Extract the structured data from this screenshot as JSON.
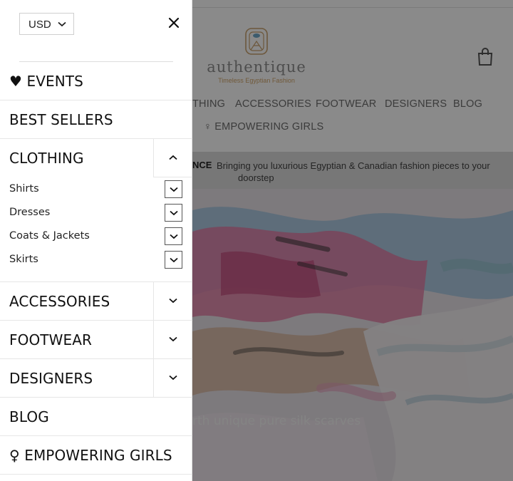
{
  "site": {
    "brand_name": "authentique",
    "tagline": "Timeless Egyptian Fashion",
    "nav": [
      "THING",
      "ACCESSORIES",
      "FOOTWEAR",
      "DESIGNERS",
      "BLOG"
    ],
    "nav_row2": "♀ EMPOWERING GIRLS",
    "banner_bold": "NCE",
    "banner_text_line1": "Bringing you luxurious Egyptian & Canadian fashion pieces to your",
    "banner_text_line2": "doorstep",
    "hero_caption": "rth unique pure silk scarves",
    "accent_color": "#d0a46a"
  },
  "drawer": {
    "currency": "USD",
    "menu": [
      {
        "label": "♥ EVENTS"
      },
      {
        "label": "BEST SELLERS"
      },
      {
        "label": "CLOTHING",
        "expanded": true
      },
      {
        "label": "ACCESSORIES"
      },
      {
        "label": "FOOTWEAR"
      },
      {
        "label": "DESIGNERS"
      },
      {
        "label": "BLOG"
      },
      {
        "label": "♀ EMPOWERING GIRLS"
      }
    ],
    "clothing_sub": [
      {
        "label": "Shirts"
      },
      {
        "label": "Dresses"
      },
      {
        "label": "Coats & Jackets"
      },
      {
        "label": "Skirts"
      }
    ]
  }
}
